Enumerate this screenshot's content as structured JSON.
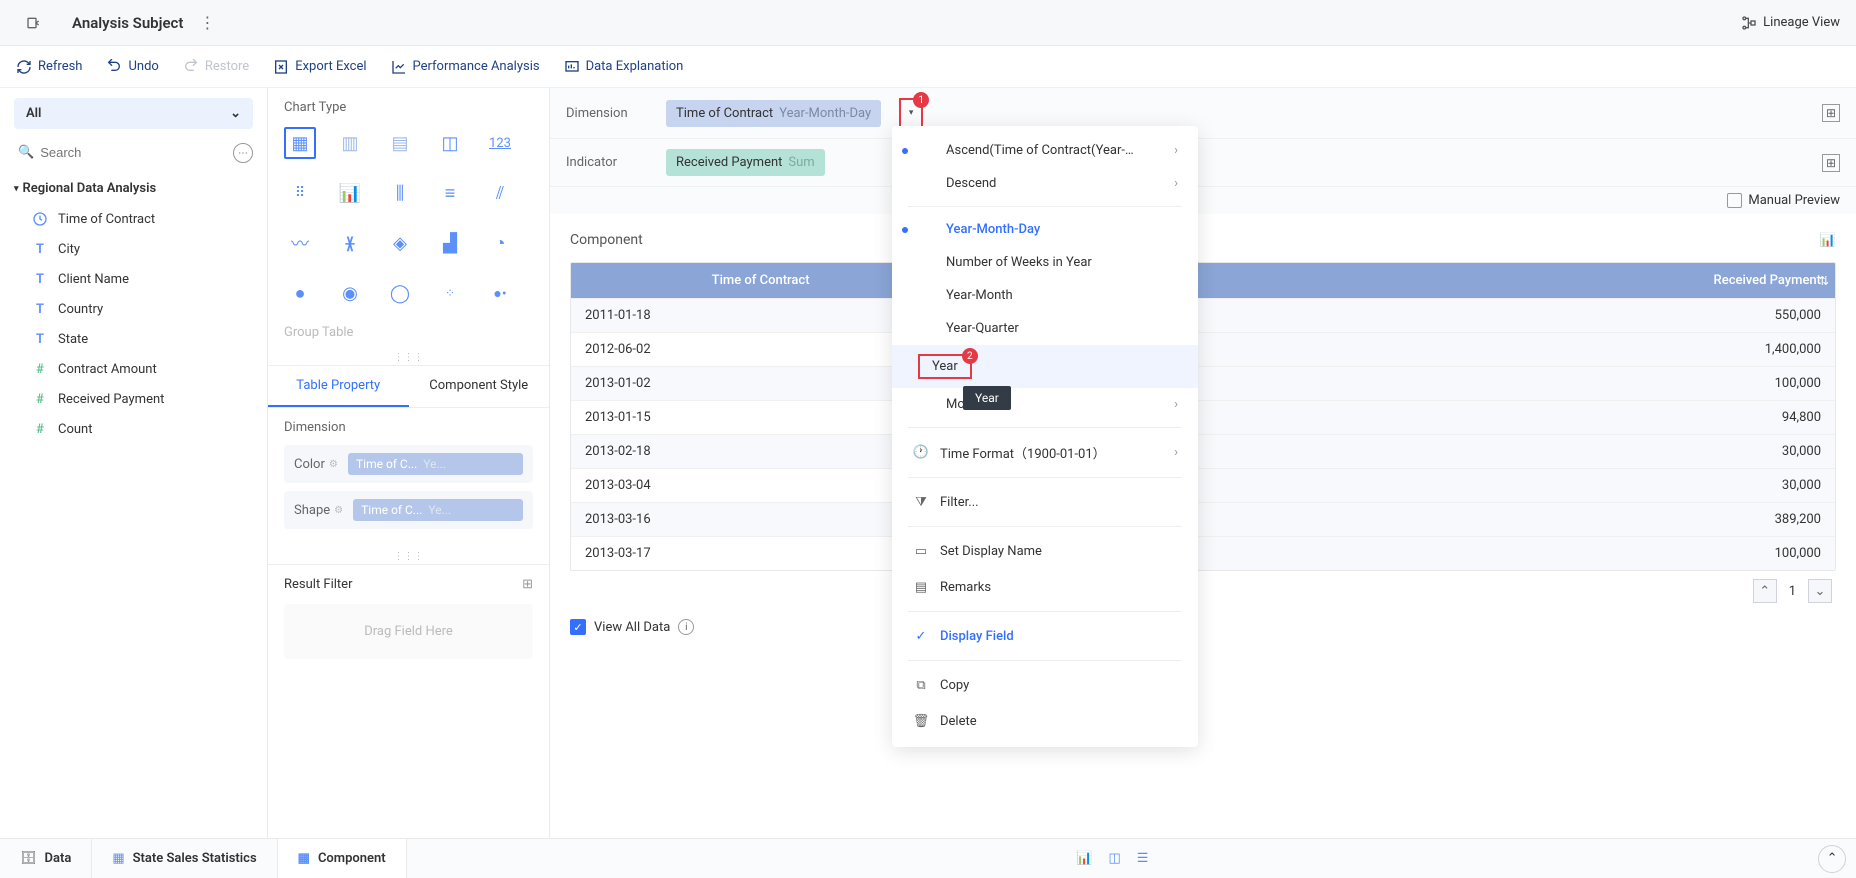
{
  "header": {
    "title": "Analysis Subject",
    "lineage": "Lineage View"
  },
  "toolbar": {
    "refresh": "Refresh",
    "undo": "Undo",
    "restore": "Restore",
    "export": "Export Excel",
    "performance": "Performance Analysis",
    "explanation": "Data Explanation"
  },
  "left": {
    "all": "All",
    "search_placeholder": "Search",
    "root": "Regional Data Analysis",
    "fields": [
      {
        "name": "time-of-contract",
        "label": "Time of Contract",
        "type": "time"
      },
      {
        "name": "city",
        "label": "City",
        "type": "text"
      },
      {
        "name": "client-name",
        "label": "Client Name",
        "type": "text"
      },
      {
        "name": "country",
        "label": "Country",
        "type": "text"
      },
      {
        "name": "state",
        "label": "State",
        "type": "text"
      },
      {
        "name": "contract-amount",
        "label": "Contract Amount",
        "type": "num"
      },
      {
        "name": "received-payment",
        "label": "Received Payment",
        "type": "num"
      },
      {
        "name": "count",
        "label": "Count",
        "type": "num"
      }
    ]
  },
  "mid": {
    "chart_type_label": "Chart Type",
    "group_table": "Group Table",
    "tabs": {
      "property": "Table Property",
      "style": "Component Style"
    },
    "dimension_label": "Dimension",
    "color_label": "Color",
    "shape_label": "Shape",
    "pill_text": "Time of C...",
    "pill_suffix": "Ye...",
    "result_filter": "Result Filter",
    "drag_here": "Drag Field Here"
  },
  "right": {
    "dimension_label": "Dimension",
    "dimension_pill": "Time of Contract",
    "dimension_pill_suffix": "Year-Month-Day",
    "badge1": "1",
    "indicator_label": "Indicator",
    "indicator_pill": "Received Payment",
    "indicator_pill_suffix": "Sum",
    "manual_preview": "Manual Preview",
    "component_label": "Component",
    "table": {
      "headers": [
        "Time of Contract",
        "Received Payment"
      ],
      "rows": [
        {
          "date": "2011-01-18",
          "value": "550,000"
        },
        {
          "date": "2012-06-02",
          "value": "1,400,000"
        },
        {
          "date": "2013-01-02",
          "value": "100,000"
        },
        {
          "date": "2013-01-15",
          "value": "94,800"
        },
        {
          "date": "2013-02-18",
          "value": "30,000"
        },
        {
          "date": "2013-03-04",
          "value": "30,000"
        },
        {
          "date": "2013-03-16",
          "value": "389,200"
        },
        {
          "date": "2013-03-17",
          "value": "100,000"
        }
      ]
    },
    "page_number": "1",
    "view_all": "View All Data"
  },
  "dropdown": {
    "ascend": "Ascend(Time of Contract(Year-Mon...",
    "descend": "Descend",
    "ymd": "Year-Month-Day",
    "weeks": "Number of Weeks in Year",
    "ym": "Year-Month",
    "yq": "Year-Quarter",
    "year": "Year",
    "year_badge": "2",
    "year_tooltip": "Year",
    "more": "More",
    "time_format": "Time Format（1900-01-01）",
    "filter": "Filter...",
    "set_display_name": "Set Display Name",
    "remarks": "Remarks",
    "display_field": "Display Field",
    "copy": "Copy",
    "delete": "Delete"
  },
  "footer": {
    "data": "Data",
    "state_sales": "State Sales Statistics",
    "component": "Component"
  }
}
